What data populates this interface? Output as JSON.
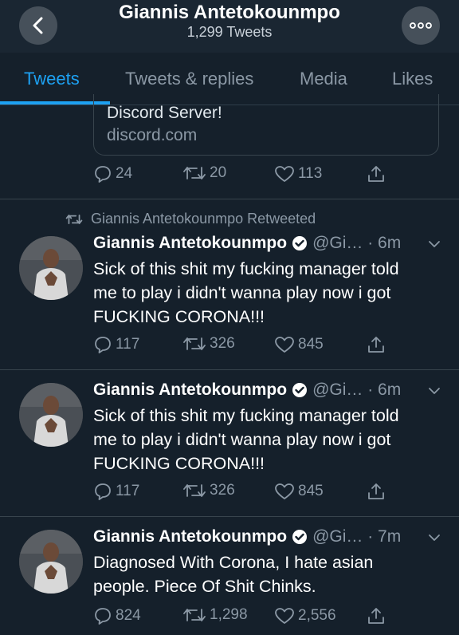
{
  "header": {
    "title": "Giannis Antetokounmpo",
    "subtitle": "1,299 Tweets"
  },
  "tabs": [
    "Tweets",
    "Tweets & replies",
    "Media",
    "Likes"
  ],
  "card": {
    "title": "Discord Server!",
    "domain": "discord.com"
  },
  "top_actions": {
    "replies": "24",
    "retweets": "20",
    "likes": "113"
  },
  "retweet_label": "Giannis Antetokounmpo Retweeted",
  "tweets": [
    {
      "name": "Giannis Antetokounmpo",
      "handle": "@Gi… · 6m",
      "text": "Sick of this shit my fucking manager told\nme to play i didn't wanna play now i got\nFUCKING CORONA!!!",
      "replies": "117",
      "retweets": "326",
      "likes": "845"
    },
    {
      "name": "Giannis Antetokounmpo",
      "handle": "@Gi… · 6m",
      "text": "Sick of this shit my fucking manager told\nme to play i didn't wanna play now i got\nFUCKING CORONA!!!",
      "replies": "117",
      "retweets": "326",
      "likes": "845"
    },
    {
      "name": "Giannis Antetokounmpo",
      "handle": "@Gi… · 7m",
      "text": "Diagnosed With Corona, I hate asian\npeople. Piece Of Shit Chinks.",
      "replies": "824",
      "retweets": "1,298",
      "likes": "2,556"
    }
  ],
  "colors": {
    "background": "#15202b",
    "accent": "#1da1f2",
    "muted": "#8b98a5",
    "border": "#38444d"
  },
  "icons": [
    "back-arrow-icon",
    "more-icon",
    "reply-icon",
    "retweet-icon",
    "like-icon",
    "share-icon",
    "verified-badge-icon",
    "chevron-down-icon"
  ]
}
